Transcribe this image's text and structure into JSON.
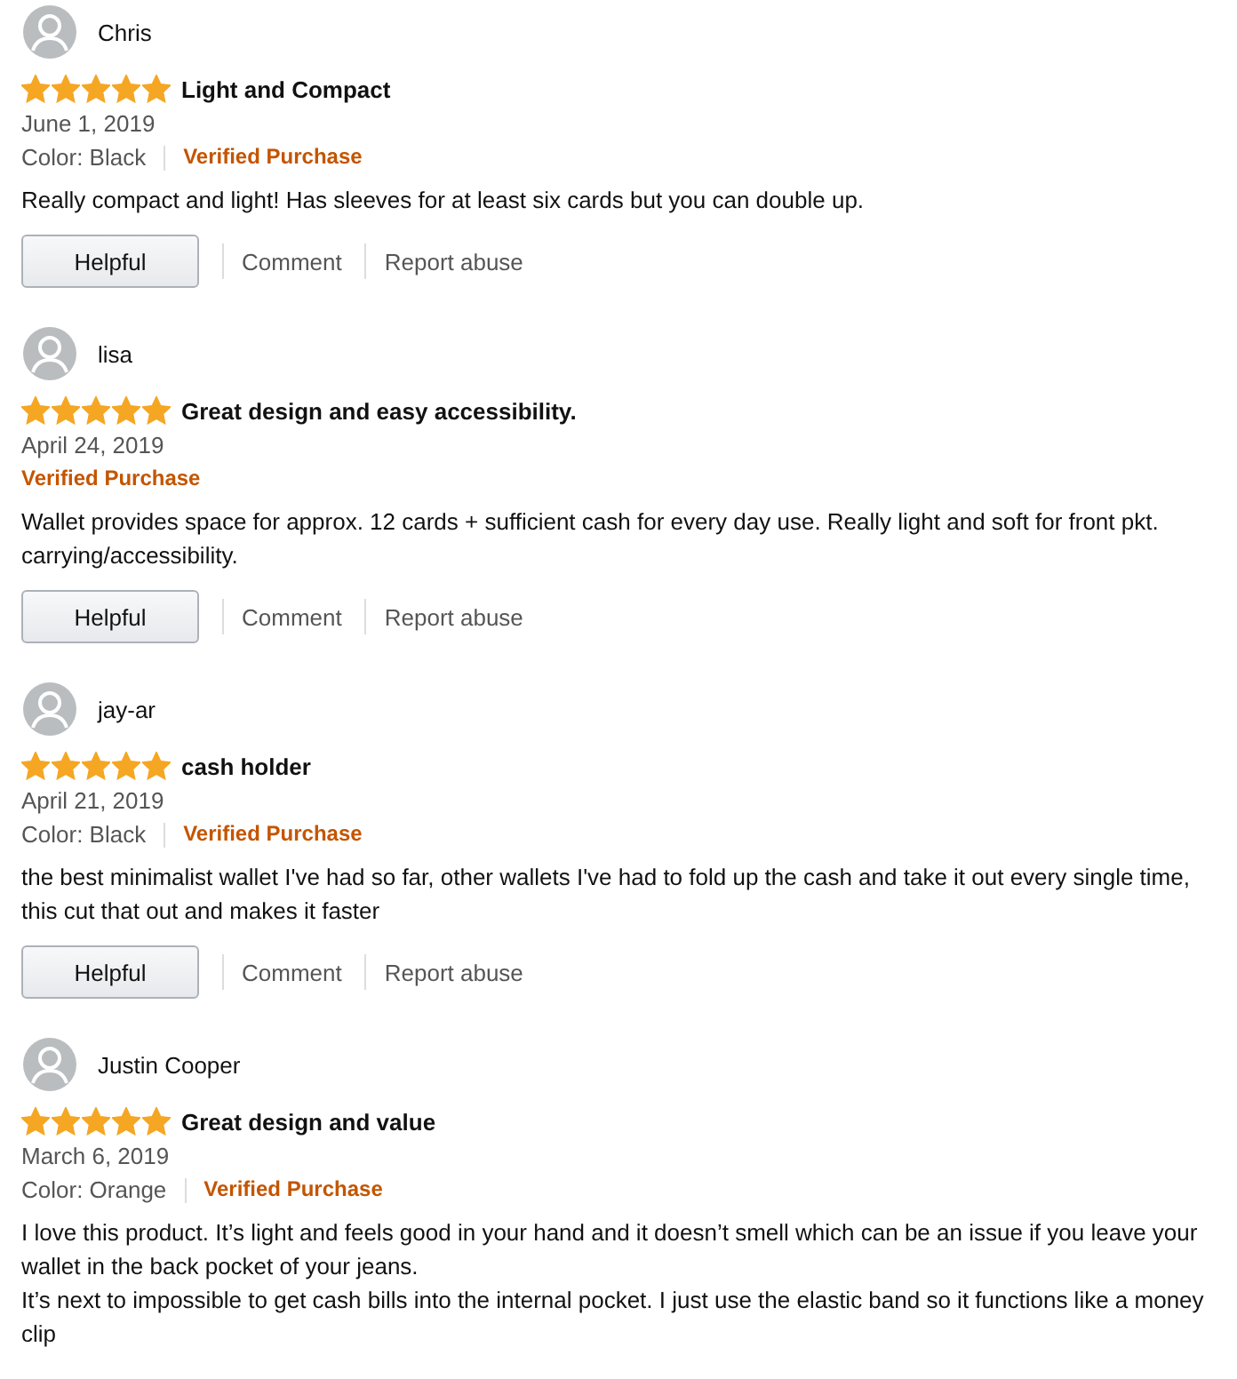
{
  "reviews": [
    {
      "author": "Chris",
      "stars": 5,
      "title": "Light and Compact",
      "date": "June 1, 2019",
      "variant": "Color: Black",
      "badge": "Verified Purchase",
      "paragraphs": [
        "Really compact and light! Has sleeves for at least six cards but you can double up."
      ],
      "actions": {
        "helpful": "Helpful",
        "comment": "Comment",
        "report": "Report abuse"
      }
    },
    {
      "author": "lisa",
      "stars": 5,
      "title": "Great design and easy accessibility.",
      "date": "April 24, 2019",
      "badge": "Verified Purchase",
      "paragraphs": [
        "Wallet provides space for approx. 12 cards + sufficient cash for every day use. Really light and soft for front pkt. carrying/accessibility."
      ],
      "actions": {
        "helpful": "Helpful",
        "comment": "Comment",
        "report": "Report abuse"
      }
    },
    {
      "author": "jay-ar",
      "stars": 5,
      "title": "cash holder",
      "date": "April 21, 2019",
      "variant": "Color: Black",
      "badge": "Verified Purchase",
      "paragraphs": [
        "the best minimalist wallet I've had so far, other wallets I've had to fold up the cash and take it out every single time, this cut that out and makes it faster"
      ],
      "actions": {
        "helpful": "Helpful",
        "comment": "Comment",
        "report": "Report abuse"
      }
    },
    {
      "author": "Justin Cooper",
      "stars": 5,
      "title": "Great design and value",
      "date": "March 6, 2019",
      "variant": "Color: Orange",
      "badge": "Verified Purchase",
      "paragraphs": [
        "I love this product. It’s light and feels good in your hand and it doesn’t smell which can be an issue if you leave your wallet in the back pocket of your jeans.",
        "It’s next to impossible to get cash bills into the internal pocket. I just use the elastic band so it functions like a money clip"
      ]
    }
  ]
}
